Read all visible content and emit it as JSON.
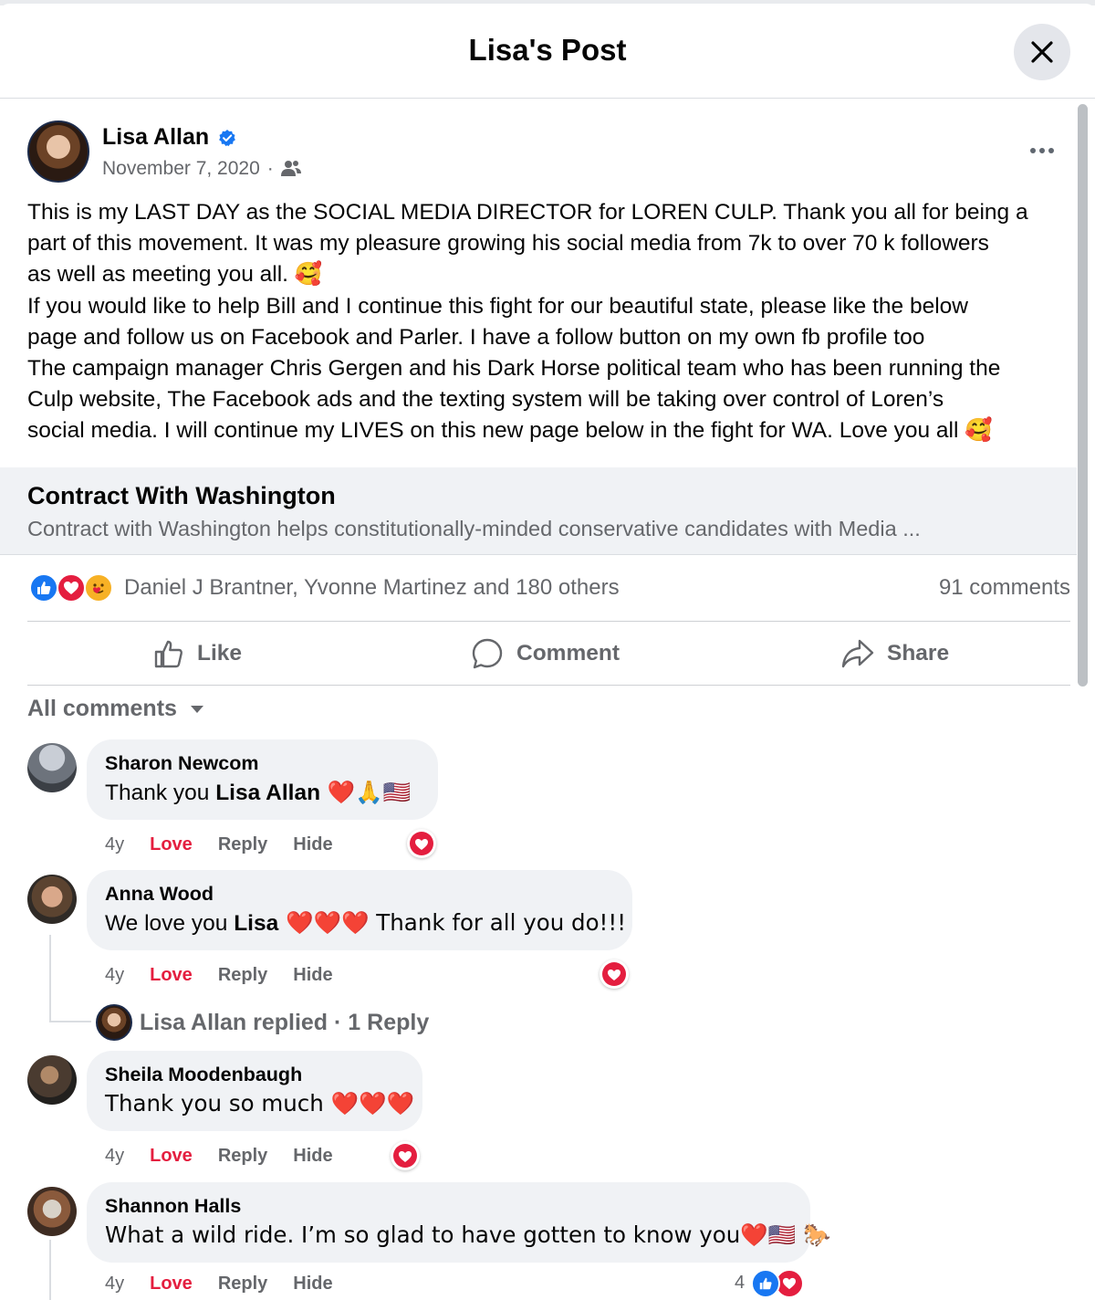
{
  "header": {
    "title": "Lisa's Post"
  },
  "post": {
    "author": "Lisa Allan",
    "date": "November 7, 2020",
    "separator": "·",
    "lines": [
      "This is my LAST DAY as the SOCIAL MEDIA DIRECTOR for LOREN CULP. Thank you all for being a",
      "part of this movement. It was my pleasure growing his social media from 7k to over 70 k followers",
      "as well as meeting you all. 🥰",
      "If you would like to help Bill and I continue this fight for our beautiful state, please like the below",
      "page and follow us on Facebook and Parler. I have a follow button on my own fb profile too",
      "The campaign manager Chris Gergen and his Dark Horse political team who has been running the",
      "Culp website, The Facebook ads and the texting system will be taking over control of Loren’s",
      "social media. I will continue my LIVES on this new page below in the fight for WA. Love you all 🥰"
    ]
  },
  "link_card": {
    "title": "Contract With Washington",
    "description": "Contract with Washington helps constitutionally-minded conservative candidates with Media ..."
  },
  "stats": {
    "reactors": "Daniel J Brantner, Yvonne Martinez and 180 others",
    "comments": "91 comments"
  },
  "actions": {
    "like": "Like",
    "comment": "Comment",
    "share": "Share"
  },
  "filter": {
    "label": "All comments"
  },
  "comments": [
    {
      "name": "Sharon Newcom",
      "text_prefix": "Thank you ",
      "mention": "Lisa Allan",
      "text_suffix": " ❤️🙏🇺🇸",
      "age": "4y",
      "love": "Love",
      "reply": "Reply",
      "hide": "Hide"
    },
    {
      "name": "Anna Wood",
      "text_prefix": "We love you ",
      "mention": "Lisa",
      "text_suffix": " ❤️❤️❤️ Thank for all you do!!!",
      "age": "4y",
      "love": "Love",
      "reply": "Reply",
      "hide": "Hide"
    },
    {
      "name": "Sheila Moodenbaugh",
      "text_prefix": "Thank you so much ❤️❤️❤️",
      "mention": "",
      "text_suffix": "",
      "age": "4y",
      "love": "Love",
      "reply": "Reply",
      "hide": "Hide"
    },
    {
      "name": "Shannon Halls",
      "text_prefix": "What a wild ride. I’m so glad to have gotten to know you❤️🇺🇸 🐎",
      "mention": "",
      "text_suffix": "",
      "age": "4y",
      "love": "Love",
      "reply": "Reply",
      "hide": "Hide",
      "reaction_count": "4"
    }
  ],
  "reply_summary": "Lisa Allan replied · 1 Reply",
  "colors": {
    "accent": "#1877f2",
    "love": "#e41e3f",
    "secondary_text": "#65676b",
    "bubble": "#f0f2f5"
  },
  "icons": {
    "close": "close-icon",
    "verified": "verified-badge-icon",
    "audience": "friends-icon",
    "more": "more-options-icon",
    "like": "thumbs-up-icon",
    "comment": "comment-bubble-icon",
    "share": "share-arrow-icon",
    "dropdown": "caret-down-icon"
  }
}
